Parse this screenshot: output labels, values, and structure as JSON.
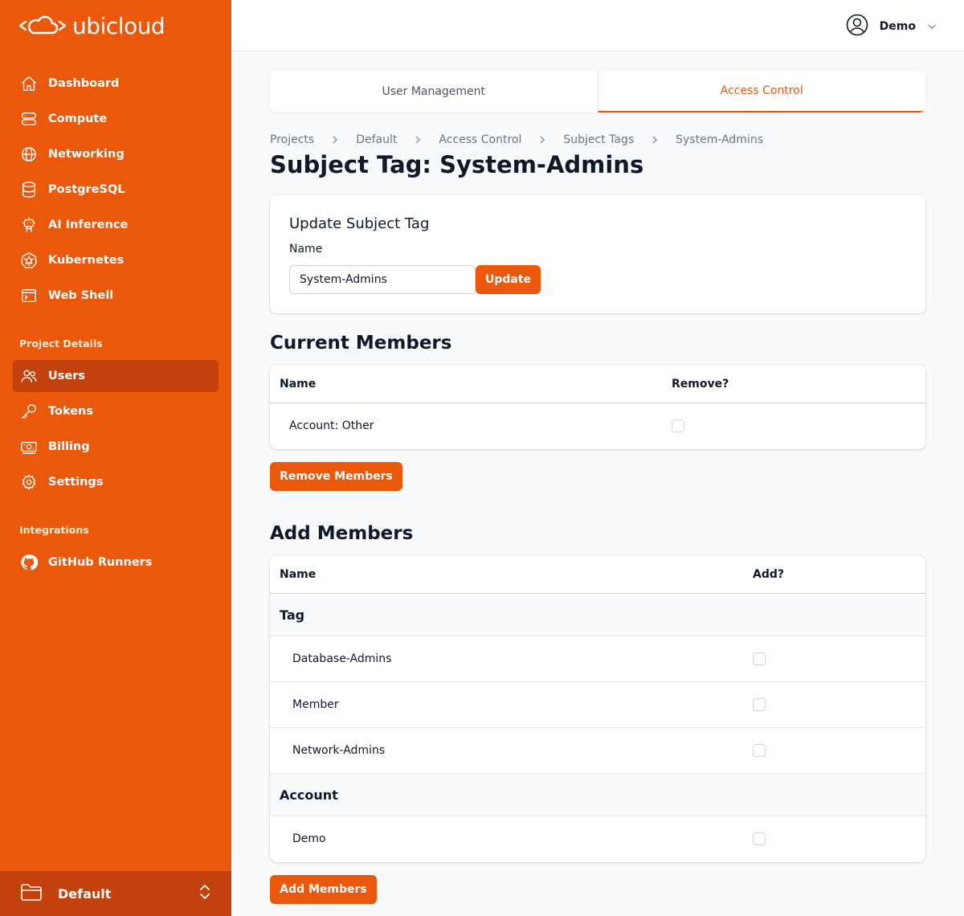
{
  "brand": {
    "name": "ubicloud"
  },
  "sidebar": {
    "main_items": [
      {
        "label": "Dashboard",
        "icon": "home-icon"
      },
      {
        "label": "Compute",
        "icon": "server-icon"
      },
      {
        "label": "Networking",
        "icon": "globe-icon"
      },
      {
        "label": "PostgreSQL",
        "icon": "database-icon"
      },
      {
        "label": "AI Inference",
        "icon": "robot-icon"
      },
      {
        "label": "Kubernetes",
        "icon": "kubernetes-icon"
      },
      {
        "label": "Web Shell",
        "icon": "terminal-icon"
      }
    ],
    "project_details_label": "Project Details",
    "project_items": [
      {
        "label": "Users",
        "icon": "users-icon",
        "active": true
      },
      {
        "label": "Tokens",
        "icon": "key-icon"
      },
      {
        "label": "Billing",
        "icon": "banknote-icon"
      },
      {
        "label": "Settings",
        "icon": "gear-icon"
      }
    ],
    "integrations_label": "Integrations",
    "integration_items": [
      {
        "label": "GitHub Runners",
        "icon": "github-icon"
      }
    ],
    "project_switcher": {
      "name": "Default"
    }
  },
  "topbar": {
    "user_name": "Demo"
  },
  "tabs": [
    {
      "label": "User Management",
      "active": false
    },
    {
      "label": "Access Control",
      "active": true
    }
  ],
  "breadcrumb": [
    "Projects",
    "Default",
    "Access Control",
    "Subject Tags",
    "System-Admins"
  ],
  "page_title": "Subject Tag: System-Admins",
  "update_form": {
    "title": "Update Subject Tag",
    "name_label": "Name",
    "name_value": "System-Admins",
    "submit_label": "Update"
  },
  "current_members": {
    "title": "Current Members",
    "columns": [
      "Name",
      "Remove?"
    ],
    "rows": [
      {
        "name": "Account: Other",
        "checked": false
      }
    ],
    "button_label": "Remove Members"
  },
  "add_members": {
    "title": "Add Members",
    "columns": [
      "Name",
      "Add?"
    ],
    "groups": [
      {
        "label": "Tag",
        "items": [
          "Database-Admins",
          "Member",
          "Network-Admins"
        ]
      },
      {
        "label": "Account",
        "items": [
          "Demo"
        ]
      }
    ],
    "button_label": "Add Members"
  },
  "colors": {
    "brand_orange": "#ea580c",
    "active_orange": "#c2410c"
  }
}
